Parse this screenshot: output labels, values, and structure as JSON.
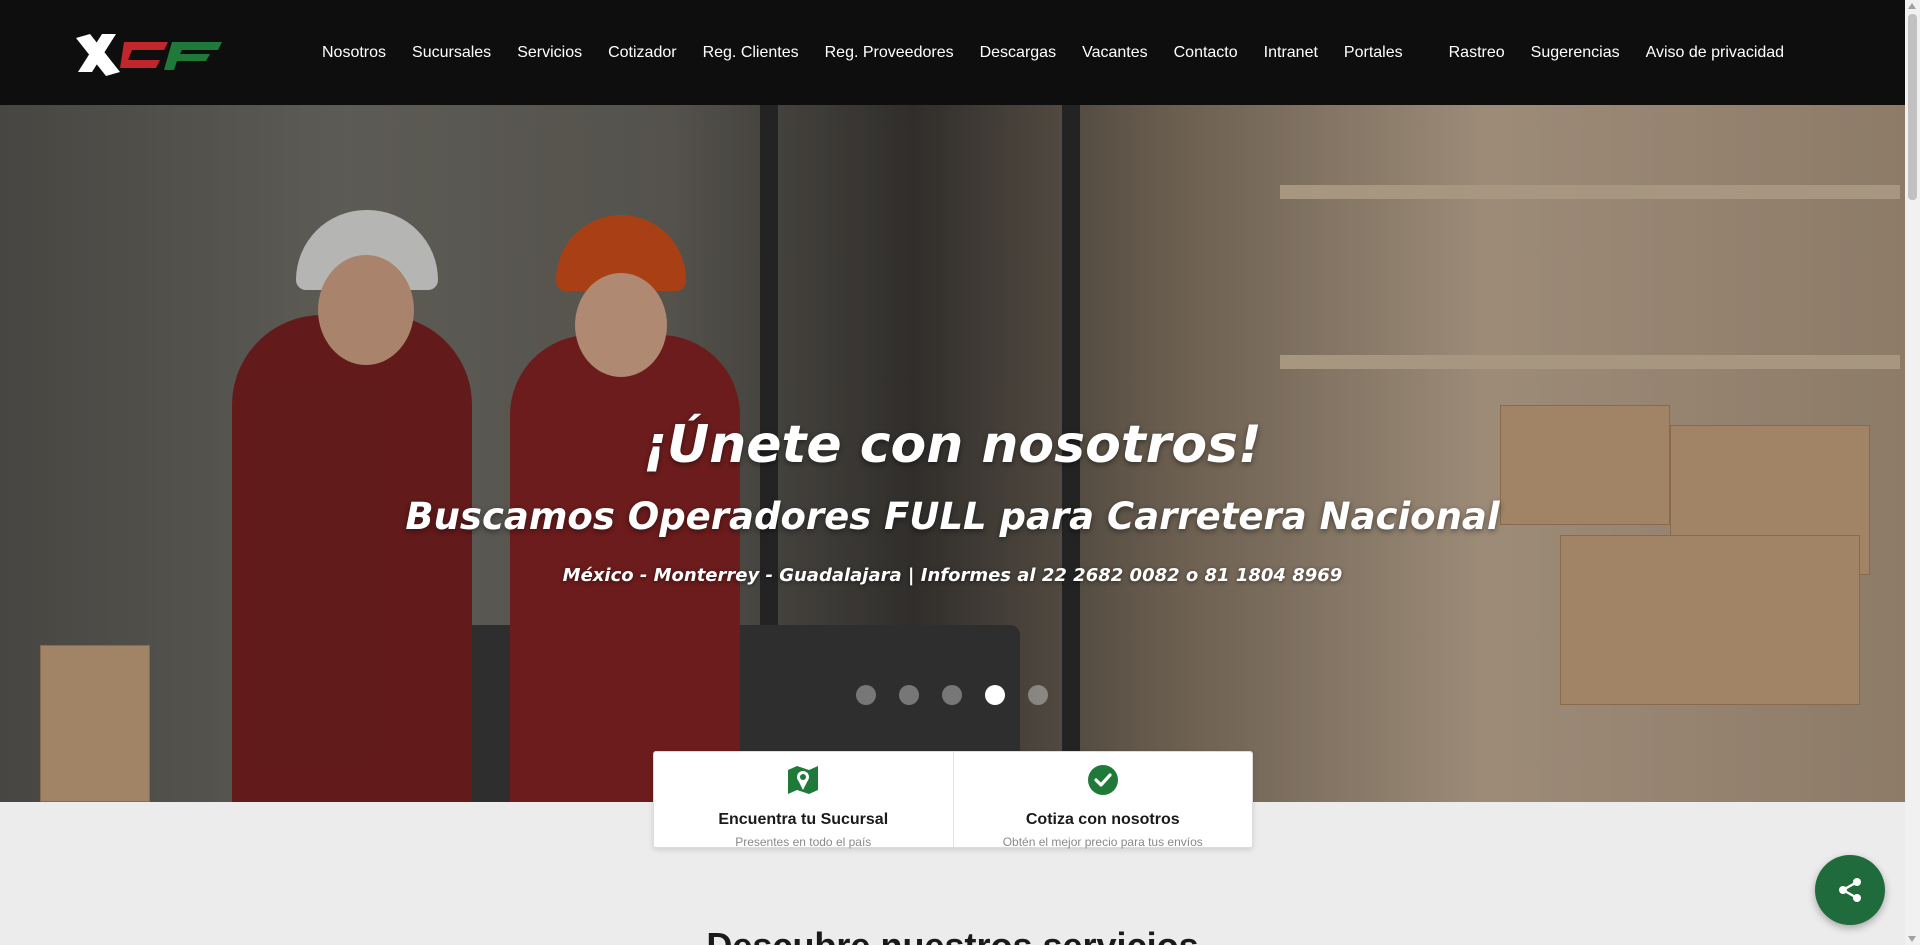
{
  "brand": {
    "logo_text": "XCF",
    "logo_colors": [
      "#ffffff",
      "#c0262c",
      "#1f7a3a"
    ]
  },
  "nav": {
    "items": [
      "Nosotros",
      "Sucursales",
      "Servicios",
      "Cotizador",
      "Reg. Clientes",
      "Reg. Proveedores",
      "Descargas",
      "Vacantes",
      "Contacto",
      "Intranet",
      "Portales",
      "Rastreo",
      "Sugerencias",
      "Aviso de privacidad"
    ]
  },
  "hero": {
    "title": "¡Únete con nosotros!",
    "subtitle": "Buscamos Operadores FULL para Carretera Nacional",
    "info": "México - Monterrey - Guadalajara | Informes al 22 2682 0082 o 81 1804 8969",
    "slides": 5,
    "active_slide": 4
  },
  "cards": [
    {
      "title": "Encuentra tu Sucursal",
      "desc": "Presentes en todo el país",
      "icon": "map-pin-icon"
    },
    {
      "title": "Cotiza con nosotros",
      "desc": "Obtén el mejor precio para tus envíos",
      "icon": "check-circle-icon"
    }
  ],
  "section": {
    "title": "Descubre nuestros servicios"
  },
  "colors": {
    "header_bg": "#0e0e0e",
    "accent_green": "#1f7a3a",
    "fab_green": "#1f6b3b"
  }
}
